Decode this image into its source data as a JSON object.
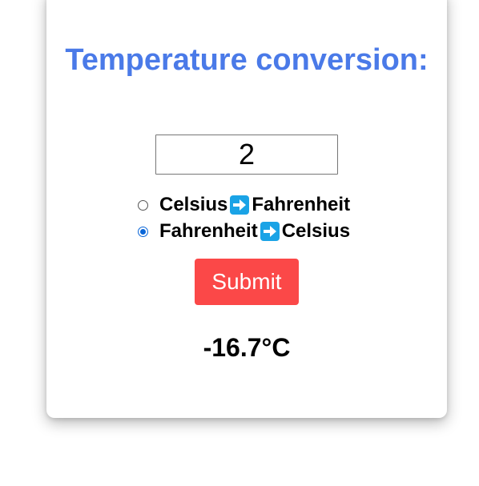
{
  "form": {
    "title": "Temperature conversion:",
    "input_value": "2",
    "options": [
      {
        "from": "Celsius",
        "to": "Fahrenheit",
        "checked": false
      },
      {
        "from": "Fahrenheit",
        "to": "Celsius",
        "checked": true
      }
    ],
    "arrow_icon": "right-arrow-icon",
    "submit_label": "Submit",
    "result": "-16.7°C"
  },
  "colors": {
    "title": "#4a7ae8",
    "submit": "#fb4848",
    "arrow": "#1aa3e6",
    "radio_checked": "#0a66d8"
  }
}
